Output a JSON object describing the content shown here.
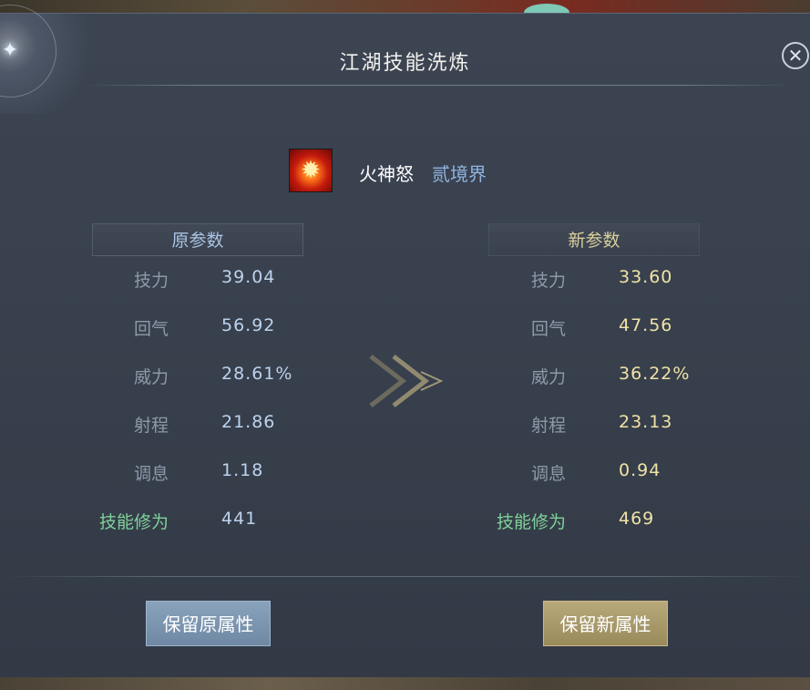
{
  "dialog": {
    "title": "江湖技能洗炼",
    "close_icon": "close-icon"
  },
  "skill": {
    "icon": "fire-skill-icon",
    "name": "火神怒",
    "level": "贰境界"
  },
  "old": {
    "header": "原参数",
    "rows": [
      {
        "label": "技力",
        "value": "39.04"
      },
      {
        "label": "回气",
        "value": "56.92"
      },
      {
        "label": "威力",
        "value": "28.61%"
      },
      {
        "label": "射程",
        "value": "21.86"
      },
      {
        "label": "调息",
        "value": "1.18"
      },
      {
        "label": "技能修为",
        "value": "441"
      }
    ]
  },
  "new": {
    "header": "新参数",
    "rows": [
      {
        "label": "技力",
        "value": "33.60"
      },
      {
        "label": "回气",
        "value": "47.56"
      },
      {
        "label": "威力",
        "value": "36.22%"
      },
      {
        "label": "射程",
        "value": "23.13"
      },
      {
        "label": "调息",
        "value": "0.94"
      },
      {
        "label": "技能修为",
        "value": "469"
      }
    ]
  },
  "buttons": {
    "keep_old": "保留原属性",
    "keep_new": "保留新属性"
  },
  "colors": {
    "old_value": "#bcd3ee",
    "new_value": "#efe3a6",
    "cultivation_label": "#7fd19a",
    "keep_old_button": "#7f98b3",
    "keep_new_button": "#ab9c6d"
  }
}
